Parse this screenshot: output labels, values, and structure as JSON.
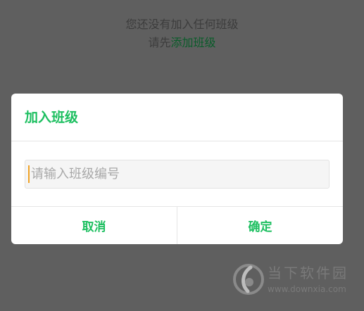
{
  "background": {
    "empty_message": "您还没有加入任何班级",
    "hint_prefix": "请先",
    "hint_link": "添加班级"
  },
  "dialog": {
    "title": "加入班级",
    "input": {
      "placeholder": "请输入班级编号",
      "value": ""
    },
    "cancel_label": "取消",
    "confirm_label": "确定"
  },
  "watermark": {
    "name": "当下软件园",
    "url": "www.downxia.com"
  },
  "colors": {
    "accent": "#1dbf60",
    "overlay": "#5f5f5f",
    "caret": "#f0a326"
  }
}
